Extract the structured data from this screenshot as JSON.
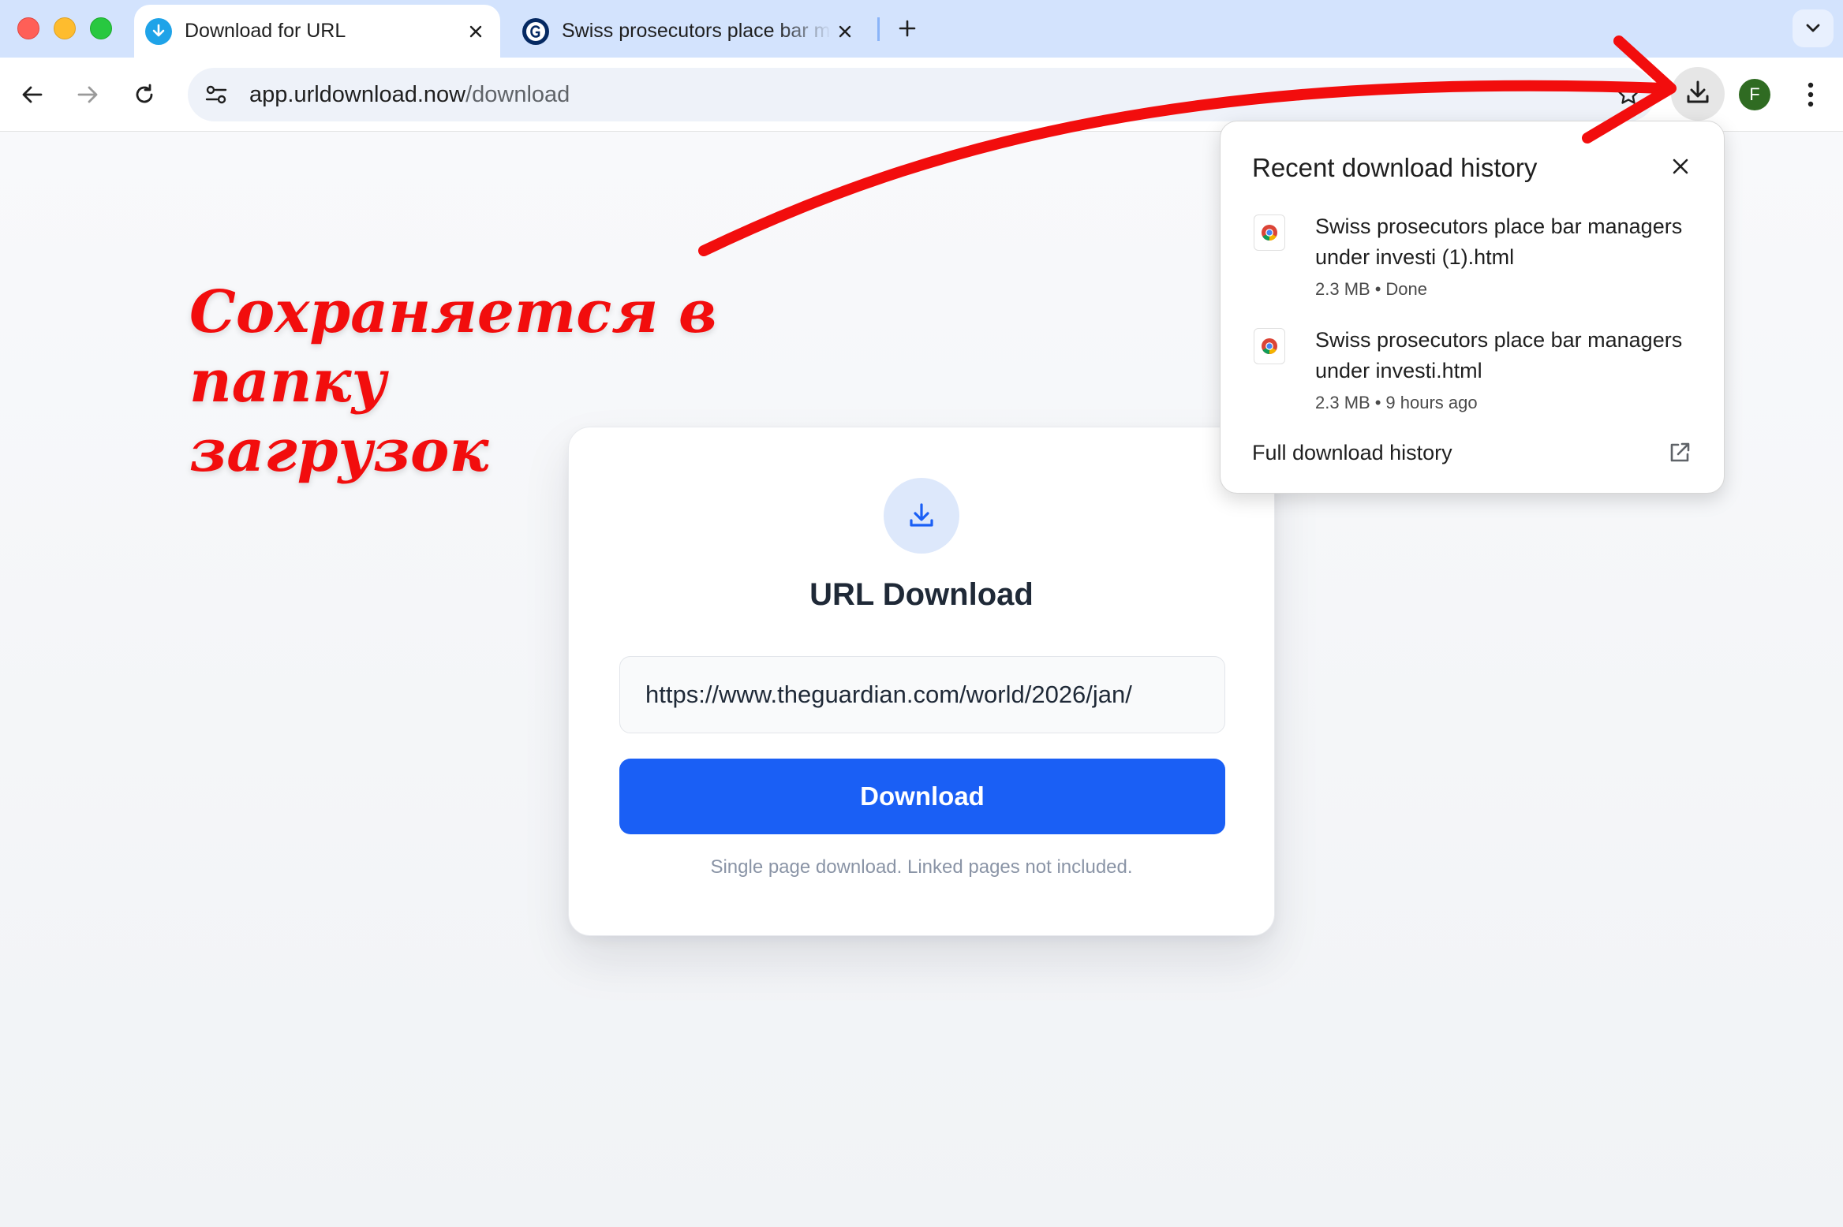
{
  "browser": {
    "tabs": [
      {
        "title": "Download for URL",
        "active": true,
        "favicon": "download-arrow-icon",
        "favicon_color": "#1fa3e8"
      },
      {
        "title": "Swiss prosecutors place bar managers under investigation",
        "active": false,
        "favicon": "guardian-g-icon",
        "favicon_color": "#052962"
      }
    ],
    "new_tab_icon": "plus-icon",
    "tab_search_icon": "chevron-down-icon",
    "address": {
      "host": "app.urldownload.now",
      "path": "/download"
    },
    "profile_initial": "F",
    "profile_color": "#2f6b22",
    "accent": "#d3e3fd"
  },
  "page": {
    "card": {
      "icon": "download-icon",
      "title": "URL Download",
      "url_value": "https://www.theguardian.com/world/2026/jan/",
      "download_label": "Download",
      "note": "Single page download. Linked pages not included.",
      "button_color": "#1a5ff5"
    }
  },
  "downloads_bubble": {
    "title": "Recent download history",
    "items": [
      {
        "name": "Swiss prosecutors place bar managers under investi (1).html",
        "size": "2.3 MB",
        "status": "Done"
      },
      {
        "name": "Swiss prosecutors place bar managers under investi.html",
        "size": "2.3 MB",
        "status": "9 hours ago"
      }
    ],
    "separator": "•",
    "full_history_label": "Full download history"
  },
  "annotation": {
    "text_line1": "Сохраняется в папку",
    "text_line2": "загрузок",
    "color": "#f20d0d"
  }
}
